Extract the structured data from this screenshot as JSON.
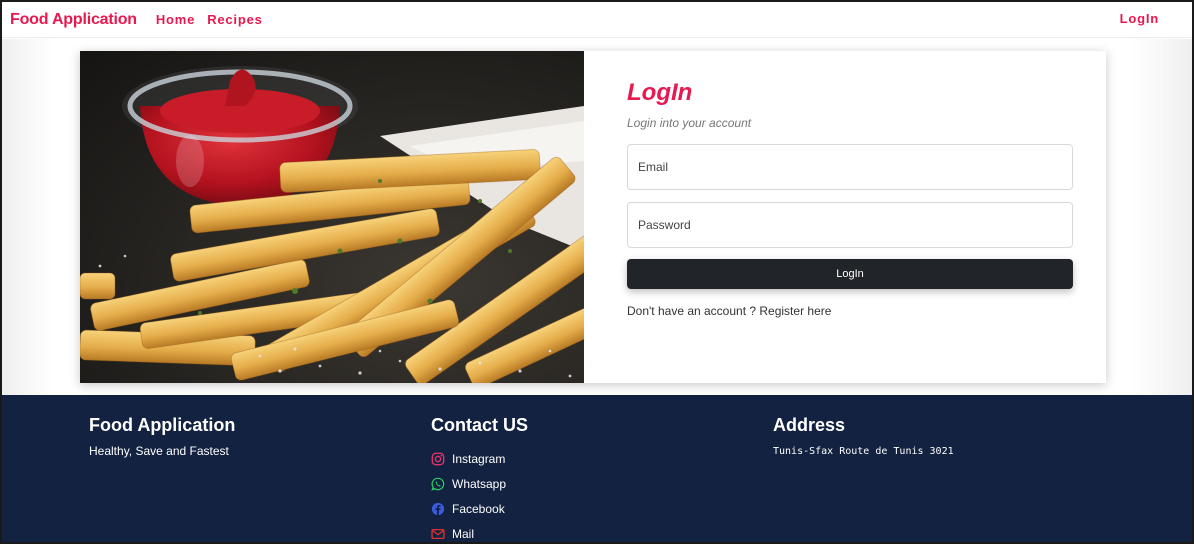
{
  "navbar": {
    "brand": "Food Application",
    "links": [
      "Home",
      "Recipes"
    ],
    "login": "LogIn"
  },
  "login": {
    "title": "LogIn",
    "subtitle": "Login into your account",
    "email_placeholder": "Email",
    "password_placeholder": "Password",
    "button_label": "LogIn",
    "register_text": "Don't have an account ? Register here"
  },
  "footer": {
    "brand": {
      "title": "Food Application",
      "tagline": "Healthy, Save and Fastest"
    },
    "contact": {
      "title": "Contact US",
      "items": [
        {
          "label": "Instagram",
          "icon": "instagram-icon",
          "color": "#e1306c"
        },
        {
          "label": "Whatsapp",
          "icon": "whatsapp-icon",
          "color": "#25d366"
        },
        {
          "label": "Facebook",
          "icon": "facebook-icon",
          "color": "#3b5bdb"
        },
        {
          "label": "Mail",
          "icon": "mail-icon",
          "color": "#e03131"
        }
      ]
    },
    "address": {
      "title": "Address",
      "text": "Tunis-Sfax Route de Tunis 3021"
    }
  },
  "colors": {
    "accent": "#e8194f",
    "footer_bg": "#122240",
    "button_bg": "#212529"
  }
}
